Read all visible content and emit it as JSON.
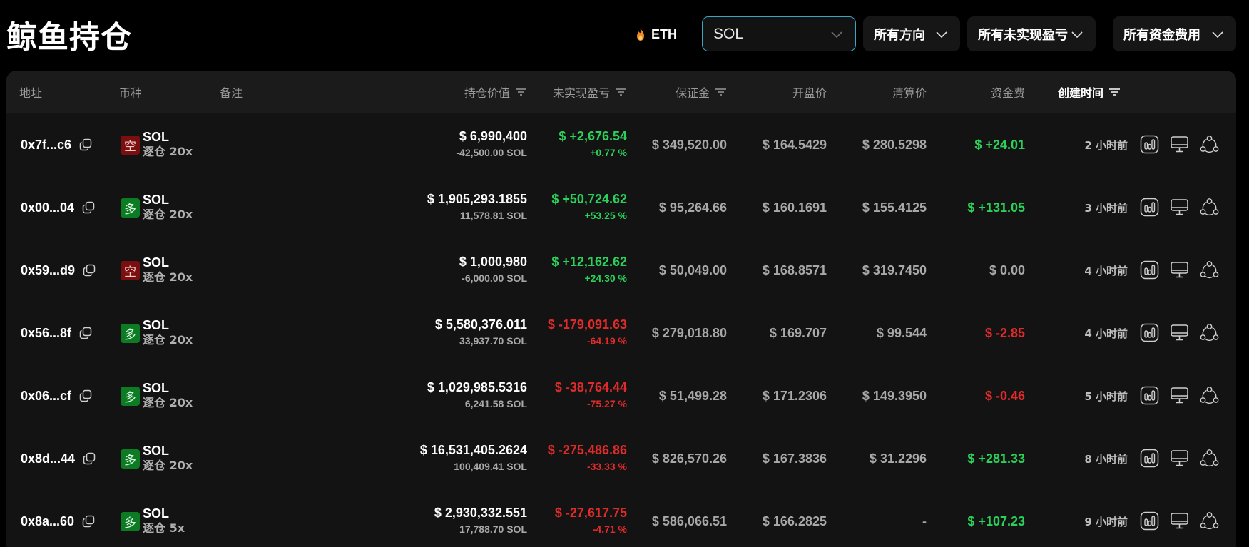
{
  "header": {
    "title": "鲸鱼持仓",
    "eth_link": "ETH",
    "coin_select": "SOL",
    "direction_select": "所有方向",
    "pnl_select": "所有未实现盈亏",
    "funding_select": "所有资金费用"
  },
  "table": {
    "columns": {
      "address": "地址",
      "coin": "币种",
      "note": "备注",
      "position_value": "持仓价值",
      "unrealized_pnl": "未实现盈亏",
      "margin": "保证金",
      "entry_price": "开盘价",
      "liq_price": "清算价",
      "funding": "资金费",
      "created": "创建时间"
    },
    "rows": [
      {
        "address": "0x7f...c6",
        "side": "空",
        "side_type": "short",
        "coin": "SOL",
        "leverage": "逐仓 20x",
        "value": "$ 6,990,400",
        "size": "-42,500.00 SOL",
        "pnl": "$ +2,676.54",
        "pnl_pct": "+0.77 %",
        "pnl_sign": "green",
        "margin": "$ 349,520.00",
        "entry": "$ 164.5429",
        "liq": "$ 280.5298",
        "funding": "$ +24.01",
        "funding_sign": "green",
        "time": "2 小时前"
      },
      {
        "address": "0x00...04",
        "side": "多",
        "side_type": "long",
        "coin": "SOL",
        "leverage": "逐仓 20x",
        "value": "$ 1,905,293.1855",
        "size": "11,578.81 SOL",
        "pnl": "$ +50,724.62",
        "pnl_pct": "+53.25 %",
        "pnl_sign": "green",
        "margin": "$ 95,264.66",
        "entry": "$ 160.1691",
        "liq": "$ 155.4125",
        "funding": "$ +131.05",
        "funding_sign": "green",
        "time": "3 小时前"
      },
      {
        "address": "0x59...d9",
        "side": "空",
        "side_type": "short",
        "coin": "SOL",
        "leverage": "逐仓 20x",
        "value": "$ 1,000,980",
        "size": "-6,000.00 SOL",
        "pnl": "$ +12,162.62",
        "pnl_pct": "+24.30 %",
        "pnl_sign": "green",
        "margin": "$ 50,049.00",
        "entry": "$ 168.8571",
        "liq": "$ 319.7450",
        "funding": "$ 0.00",
        "funding_sign": "grey",
        "time": "4 小时前"
      },
      {
        "address": "0x56...8f",
        "side": "多",
        "side_type": "long",
        "coin": "SOL",
        "leverage": "逐仓 20x",
        "value": "$ 5,580,376.011",
        "size": "33,937.70 SOL",
        "pnl": "$ -179,091.63",
        "pnl_pct": "-64.19 %",
        "pnl_sign": "red",
        "margin": "$ 279,018.80",
        "entry": "$ 169.707",
        "liq": "$ 99.544",
        "funding": "$ -2.85",
        "funding_sign": "red",
        "time": "4 小时前"
      },
      {
        "address": "0x06...cf",
        "side": "多",
        "side_type": "long",
        "coin": "SOL",
        "leverage": "逐仓 20x",
        "value": "$ 1,029,985.5316",
        "size": "6,241.58 SOL",
        "pnl": "$ -38,764.44",
        "pnl_pct": "-75.27 %",
        "pnl_sign": "red",
        "margin": "$ 51,499.28",
        "entry": "$ 171.2306",
        "liq": "$ 149.3950",
        "funding": "$ -0.46",
        "funding_sign": "red",
        "time": "5 小时前"
      },
      {
        "address": "0x8d...44",
        "side": "多",
        "side_type": "long",
        "coin": "SOL",
        "leverage": "逐仓 20x",
        "value": "$ 16,531,405.2624",
        "size": "100,409.41 SOL",
        "pnl": "$ -275,486.86",
        "pnl_pct": "-33.33 %",
        "pnl_sign": "red",
        "margin": "$ 826,570.26",
        "entry": "$ 167.3836",
        "liq": "$ 31.2296",
        "funding": "$ +281.33",
        "funding_sign": "green",
        "time": "8 小时前"
      },
      {
        "address": "0x8a...60",
        "side": "多",
        "side_type": "long",
        "coin": "SOL",
        "leverage": "逐仓 5x",
        "value": "$ 2,930,332.551",
        "size": "17,788.70 SOL",
        "pnl": "$ -27,617.75",
        "pnl_pct": "-4.71 %",
        "pnl_sign": "red",
        "margin": "$ 586,066.51",
        "entry": "$ 166.2825",
        "liq": "-",
        "funding": "$ +107.23",
        "funding_sign": "green",
        "time": "9 小时前"
      }
    ]
  },
  "icons": {
    "eth": "flame-icon",
    "copy": "copy-icon",
    "chart": "bar-chart-icon",
    "monitor": "monitor-icon",
    "share": "share-nodes-icon",
    "sort": "sort-filter-icon",
    "chevron": "chevron-down-icon"
  },
  "colors": {
    "background": "#000000",
    "panel": "#131313",
    "header_row": "#1b1b1b",
    "positive": "#2bd05a",
    "negative": "#e02b2b",
    "short_badge": "#7a0f10",
    "long_badge": "#0d7a24",
    "select_border": "#3aa6c4",
    "flame": "#f08a24"
  }
}
